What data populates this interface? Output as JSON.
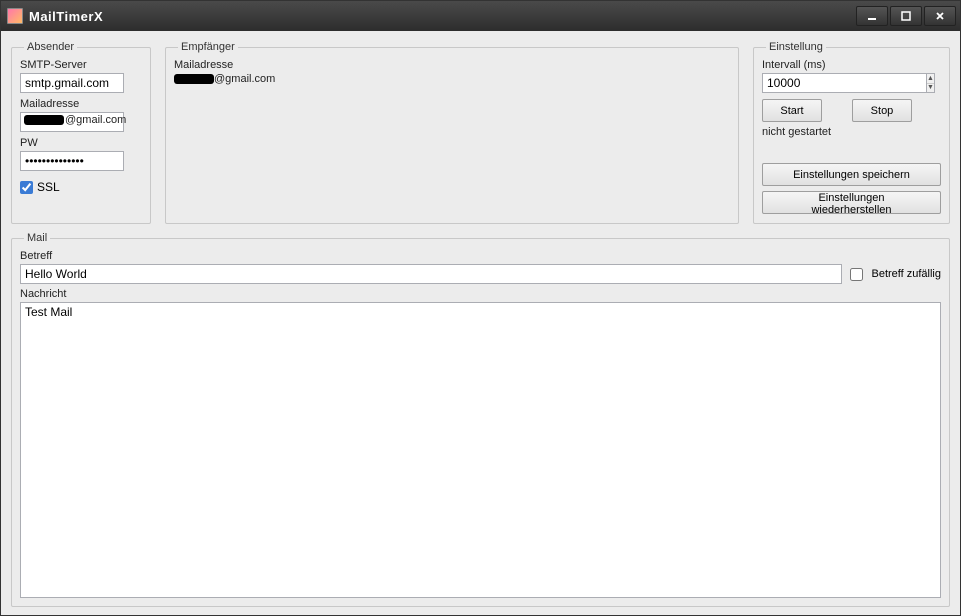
{
  "window": {
    "title": "MailTimerX"
  },
  "absender": {
    "legend": "Absender",
    "smtp_label": "SMTP-Server",
    "smtp_value": "smtp.gmail.com",
    "mail_label": "Mailadresse",
    "mail_suffix": "@gmail.com",
    "pw_label": "PW",
    "pw_value": "••••••••••••••",
    "ssl_label": "SSL",
    "ssl_checked": true
  },
  "empfaenger": {
    "legend": "Empfänger",
    "mail_label": "Mailadresse",
    "mail_suffix": "@gmail.com"
  },
  "einstellung": {
    "legend": "Einstellung",
    "interval_label": "Intervall (ms)",
    "interval_value": "10000",
    "start_label": "Start",
    "stop_label": "Stop",
    "status_text": "nicht gestartet",
    "save_label": "Einstellungen speichern",
    "restore_label": "Einstellungen wiederherstellen"
  },
  "mail": {
    "legend": "Mail",
    "betreff_label": "Betreff",
    "betreff_value": "Hello World",
    "random_label": "Betreff zufällig",
    "random_checked": false,
    "nachricht_label": "Nachricht",
    "nachricht_value": "Test Mail"
  }
}
